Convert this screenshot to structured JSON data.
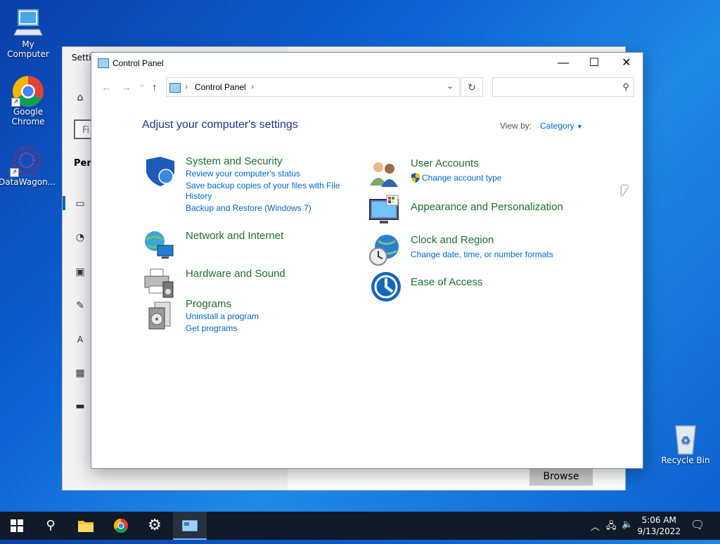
{
  "desktop": {
    "icons": [
      {
        "label": "My Computer"
      },
      {
        "label": "Google Chrome"
      },
      {
        "label": "DataWagon..."
      },
      {
        "label": "Recycle Bin"
      }
    ]
  },
  "settings_window": {
    "title": "Settin",
    "search_text": "Fi",
    "section": "Pers",
    "browse_label": "Browse"
  },
  "control_panel": {
    "title": "Control Panel",
    "address": {
      "crumb": "Control Panel"
    },
    "heading": "Adjust your computer's settings",
    "view_by_label": "View by:",
    "view_by_value": "Category",
    "categories_left": [
      {
        "name": "System and Security",
        "icon": "shield-icon",
        "links": [
          "Review your computer's status",
          "Save backup copies of your files with File",
          "History",
          "Backup and Restore (Windows 7)"
        ]
      },
      {
        "name": "Network and Internet",
        "icon": "network-icon",
        "links": []
      },
      {
        "name": "Hardware and Sound",
        "icon": "printer-icon",
        "links": []
      },
      {
        "name": "Programs",
        "icon": "programs-icon",
        "links": [
          "Uninstall a program",
          "Get programs"
        ]
      }
    ],
    "categories_right": [
      {
        "name": "User Accounts",
        "icon": "users-icon",
        "links": [
          "Change account type"
        ]
      },
      {
        "name": "Appearance and Personalization",
        "icon": "monitor-icon",
        "links": []
      },
      {
        "name": "Clock and Region",
        "icon": "clock-globe-icon",
        "links": [
          "Change date, time, or number formats"
        ]
      },
      {
        "name": "Ease of Access",
        "icon": "ease-of-access-icon",
        "links": []
      }
    ]
  },
  "taskbar": {
    "time": "5:06 AM",
    "date": "9/13/2022"
  },
  "colors": {
    "category_title": "#1e6e2e",
    "link": "#0066cc",
    "heading": "#1e3287",
    "taskbar": "#101a28"
  }
}
